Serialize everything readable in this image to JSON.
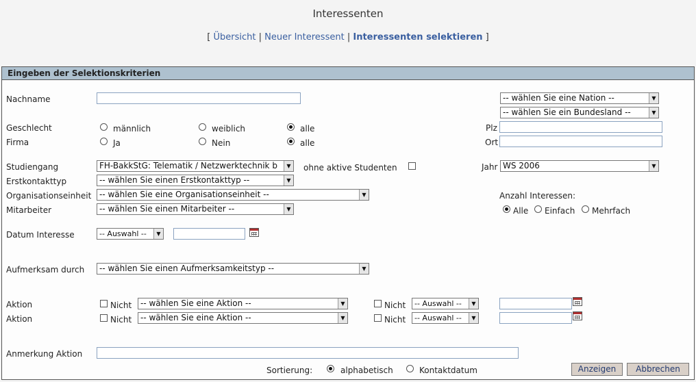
{
  "page": {
    "title": "Interessenten",
    "nav": {
      "open": "[",
      "overview": "Übersicht",
      "sep1": "|",
      "new": "Neuer Interessent",
      "sep2": "|",
      "select": "Interessenten selektieren",
      "close": "]"
    }
  },
  "panel": {
    "title": "Eingeben der Selektionskriterien",
    "nachname_label": "Nachname",
    "nation_select": "-- wählen Sie eine Nation --",
    "bundesland_select": "-- wählen Sie ein Bundesland --",
    "geschlecht_label": "Geschlecht",
    "geschlecht_options": [
      "männlich",
      "weiblich",
      "alle"
    ],
    "firma_label": "Firma",
    "firma_options": [
      "Ja",
      "Nein",
      "alle"
    ],
    "plz_label": "Plz",
    "ort_label": "Ort",
    "studiengang_label": "Studiengang",
    "studiengang_select": "FH-BakkStG: Telematik / Netzwerktechnik b",
    "ohne_aktive_label": "ohne aktive Studenten",
    "jahr_label": "Jahr",
    "jahr_select": "WS 2006",
    "erstkontakt_label": "Erstkontakttyp",
    "erstkontakt_select": "-- wählen Sie einen Erstkontakttyp --",
    "orgeinheit_label": "Organisationseinheit",
    "orgeinheit_select": "-- wählen Sie eine Organisationseinheit --",
    "mitarbeiter_label": "Mitarbeiter",
    "mitarbeiter_select": "-- wählen Sie einen Mitarbeiter --",
    "anzahl_label": "Anzahl Interessen:",
    "anzahl_options": [
      "Alle",
      "Einfach",
      "Mehrfach"
    ],
    "datum_label": "Datum Interesse",
    "datum_select": "-- Auswahl --",
    "aufmerksam_label": "Aufmerksam durch",
    "aufmerksam_select": "-- wählen Sie einen Aufmerksamkeitstyp --",
    "aktion_label": "Aktion",
    "nicht_label": "Nicht",
    "aktion_select": "-- wählen Sie eine Aktion --",
    "auswahl_select": "-- Auswahl --",
    "anmerkung_label": "Anmerkung Aktion",
    "sortierung_label": "Sortierung:",
    "sort_options": [
      "alphabetisch",
      "Kontaktdatum"
    ],
    "anzeigen_button": "Anzeigen",
    "abbrechen_button": "Abbrechen"
  }
}
